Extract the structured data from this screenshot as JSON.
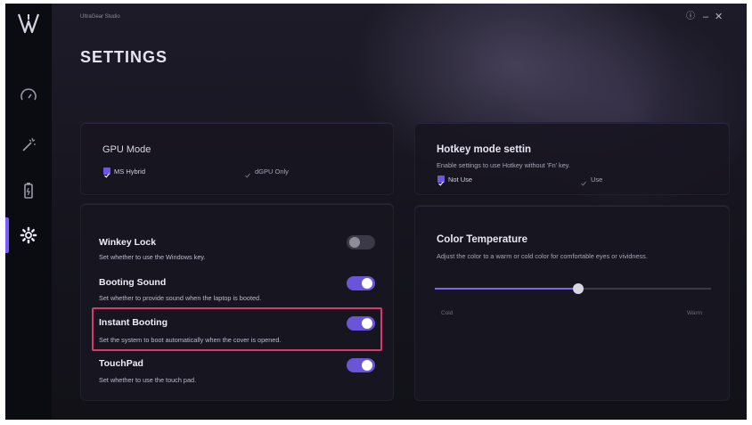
{
  "app": {
    "title": "UltraGear Studio",
    "page_title": "SETTINGS",
    "window_controls": {
      "info": "ⓘ",
      "minimize": "–",
      "close": "✕"
    }
  },
  "sidebar": {
    "items": [
      {
        "icon": "gauge-icon",
        "active": false
      },
      {
        "icon": "magic-wand-icon",
        "active": false
      },
      {
        "icon": "battery-icon",
        "active": false
      },
      {
        "icon": "gear-icon",
        "active": true
      }
    ]
  },
  "gpu_mode": {
    "title": "GPU Mode",
    "options": [
      {
        "label": "MS Hybrid",
        "checked": true
      },
      {
        "label": "dGPU Only",
        "checked": false
      }
    ]
  },
  "hotkey": {
    "title": "Hotkey mode settin",
    "description": "Enable settings to use Hotkey without 'Fn' key.",
    "options": [
      {
        "label": "Not Use",
        "checked": true
      },
      {
        "label": "Use",
        "checked": false
      }
    ]
  },
  "toggles": [
    {
      "title": "Winkey Lock",
      "description": "Set whether to use the Windows key.",
      "on": false
    },
    {
      "title": "Booting Sound",
      "description": "Set whether to provide sound when the laptop is booted.",
      "on": true
    },
    {
      "title": "Instant Booting",
      "description": "Set the system to boot automatically when the cover is opened.",
      "on": true,
      "highlighted": true
    },
    {
      "title": "TouchPad",
      "description": "Set whether to use the touch pad.",
      "on": true
    }
  ],
  "color_temperature": {
    "title": "Color Temperature",
    "description": "Adjust the color to a warm or cold color for comfortable eyes or vividness.",
    "min_label": "Cold",
    "max_label": "Warm",
    "value": 0.52
  },
  "colors": {
    "accent": "#6a55d8",
    "highlight_border": "#d9396a",
    "background": "#16151f"
  }
}
